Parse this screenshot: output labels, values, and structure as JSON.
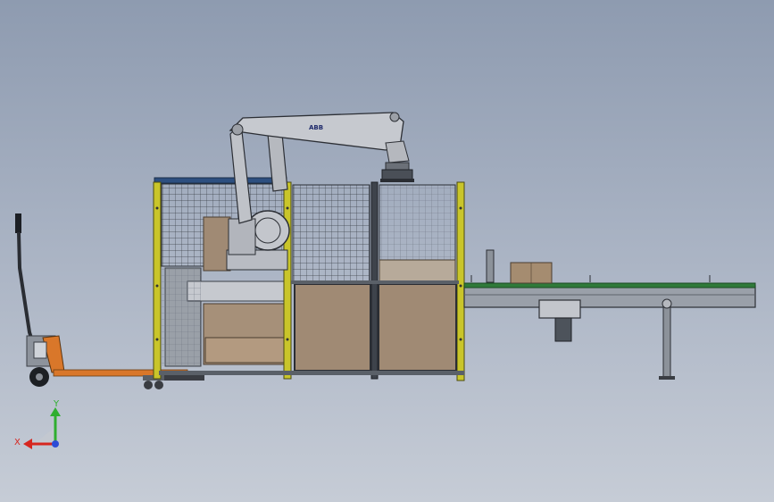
{
  "viewport": {
    "background_top": "#8e9bb0",
    "background_bottom": "#c6ccd6"
  },
  "model": {
    "robot_brand": "ABB",
    "assembly": [
      "pallet-jack",
      "safety-fence-cell",
      "palletizing-robot",
      "output-pallet",
      "infeed-roller-conveyor"
    ]
  },
  "triad": {
    "x_label": "X",
    "y_label": "Y",
    "x_color": "#d6261f",
    "y_color": "#2fae2f",
    "z_color": "#2d4cd6"
  },
  "colors": {
    "fence_post": "#c9c52a",
    "fence_mesh": "#3a3f48",
    "panel_fill": "#a08a74",
    "robot_body": "#b9bcc3",
    "jack_orange": "#d9772a",
    "conveyor_belt": "#2f7a3a"
  }
}
